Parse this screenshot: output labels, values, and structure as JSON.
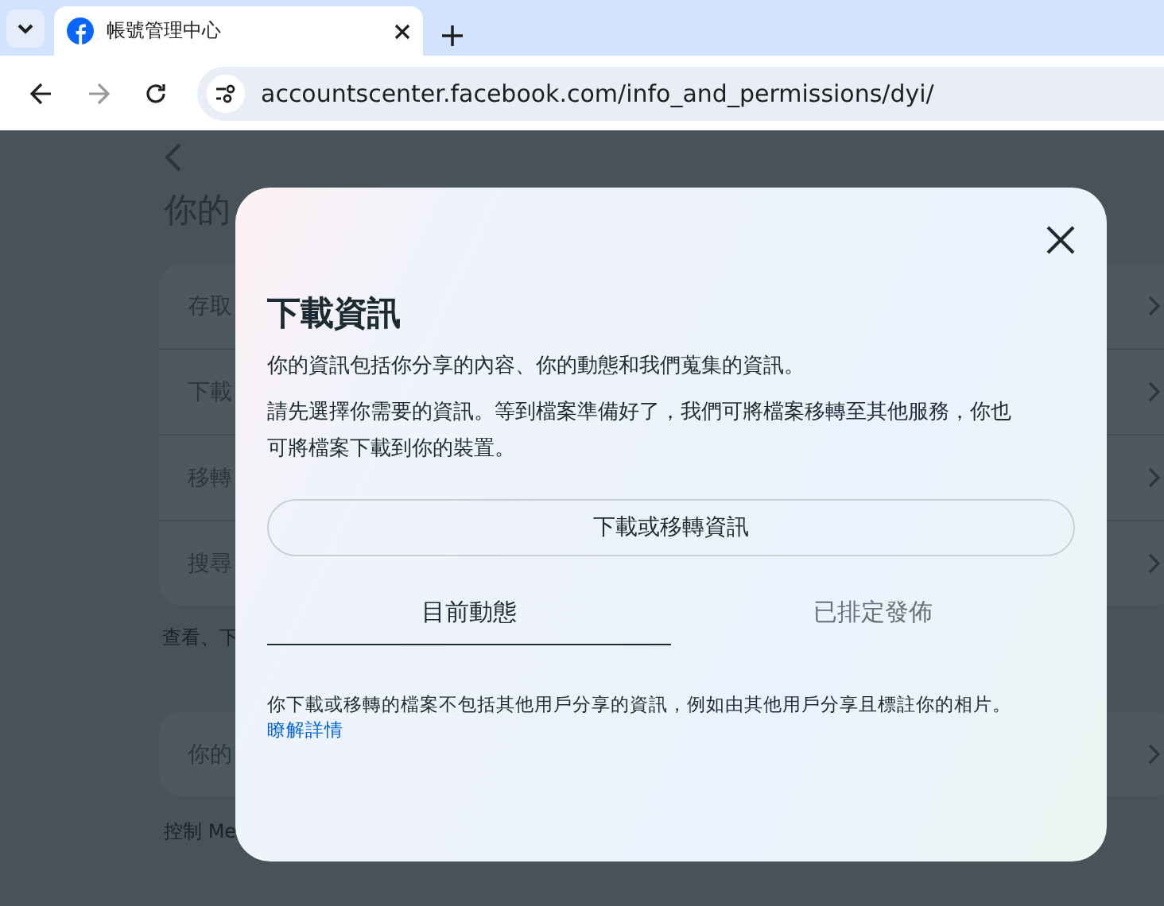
{
  "browser": {
    "tab": {
      "title": "帳號管理中心"
    },
    "url": "accountscenter.facebook.com/info_and_permissions/dyi/"
  },
  "background": {
    "heading": "你的",
    "list_items": [
      "存取",
      "下載",
      "移轉",
      "搜尋"
    ],
    "caption": "查看、下",
    "card_item": "你的",
    "footer": "控制 Me"
  },
  "dialog": {
    "title": "下載資訊",
    "paragraphs": [
      "你的資訊包括你分享的內容、你的動態和我們蒐集的資訊。",
      "請先選擇你需要的資訊。等到檔案準備好了，我們可將檔案移轉至其他服務，你也可將檔案下載到你的裝置。"
    ],
    "button": "下載或移轉資訊",
    "tabs": [
      {
        "label": "目前動態",
        "selected": true
      },
      {
        "label": "已排定發佈",
        "selected": false
      }
    ],
    "note": "你下載或移轉的檔案不包括其他用戶分享的資訊，例如由其他用戶分享且標註你的相片。",
    "link": "瞭解詳情"
  }
}
